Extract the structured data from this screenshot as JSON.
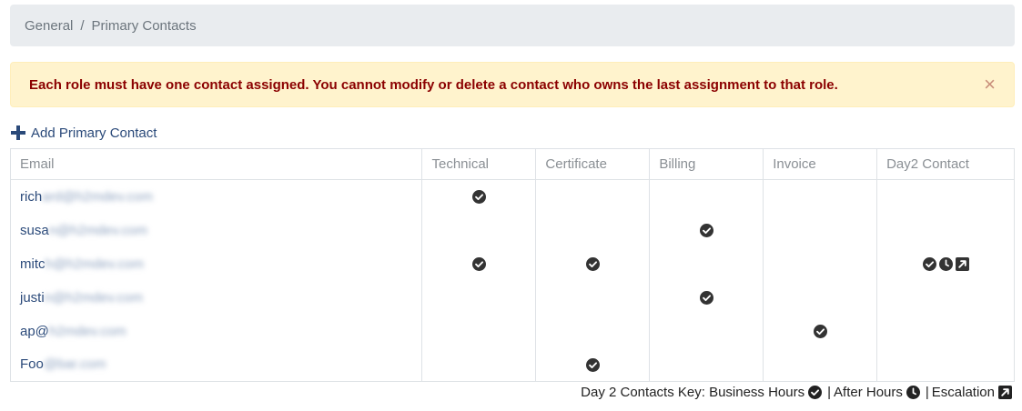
{
  "breadcrumb": {
    "items": [
      "General",
      "Primary Contacts"
    ],
    "separator": "/"
  },
  "alert": {
    "message": "Each role must have one contact assigned. You cannot modify or delete a contact who owns the last assignment to that role.",
    "close_icon": "close-icon"
  },
  "add_contact": {
    "label": "Add Primary Contact",
    "icon": "plus-icon"
  },
  "table": {
    "columns": [
      "Email",
      "Technical",
      "Certificate",
      "Billing",
      "Invoice",
      "Day2 Contact"
    ],
    "rows": [
      {
        "email_visible": "rich",
        "email_blurred": "ard@h2mdev.com",
        "technical": true,
        "certificate": false,
        "billing": false,
        "invoice": false,
        "day2": []
      },
      {
        "email_visible": "susa",
        "email_blurred": "n@h2mdev.com",
        "technical": false,
        "certificate": false,
        "billing": true,
        "invoice": false,
        "day2": []
      },
      {
        "email_visible": "mitc",
        "email_blurred": "h@h2mdev.com",
        "technical": true,
        "certificate": true,
        "billing": false,
        "invoice": false,
        "day2": [
          "check-circle-icon",
          "clock-icon",
          "escalation-icon"
        ]
      },
      {
        "email_visible": "justi",
        "email_blurred": "n@h2mdev.com",
        "technical": false,
        "certificate": false,
        "billing": true,
        "invoice": false,
        "day2": []
      },
      {
        "email_visible": "ap@",
        "email_blurred": "h2mdev.com",
        "technical": false,
        "certificate": false,
        "billing": false,
        "invoice": true,
        "day2": []
      },
      {
        "email_visible": "Foo",
        "email_blurred": "@bar.com",
        "technical": false,
        "certificate": true,
        "billing": false,
        "invoice": false,
        "day2": []
      }
    ]
  },
  "key": {
    "prefix": "Day 2 Contacts Key:",
    "business_hours": "Business Hours",
    "after_hours": "After Hours",
    "escalation": "Escalation",
    "separator": "|"
  },
  "colors": {
    "link": "#2b4a7a",
    "alert_text": "#8b0000",
    "alert_bg": "#fff3cd",
    "icon": "#333333"
  }
}
